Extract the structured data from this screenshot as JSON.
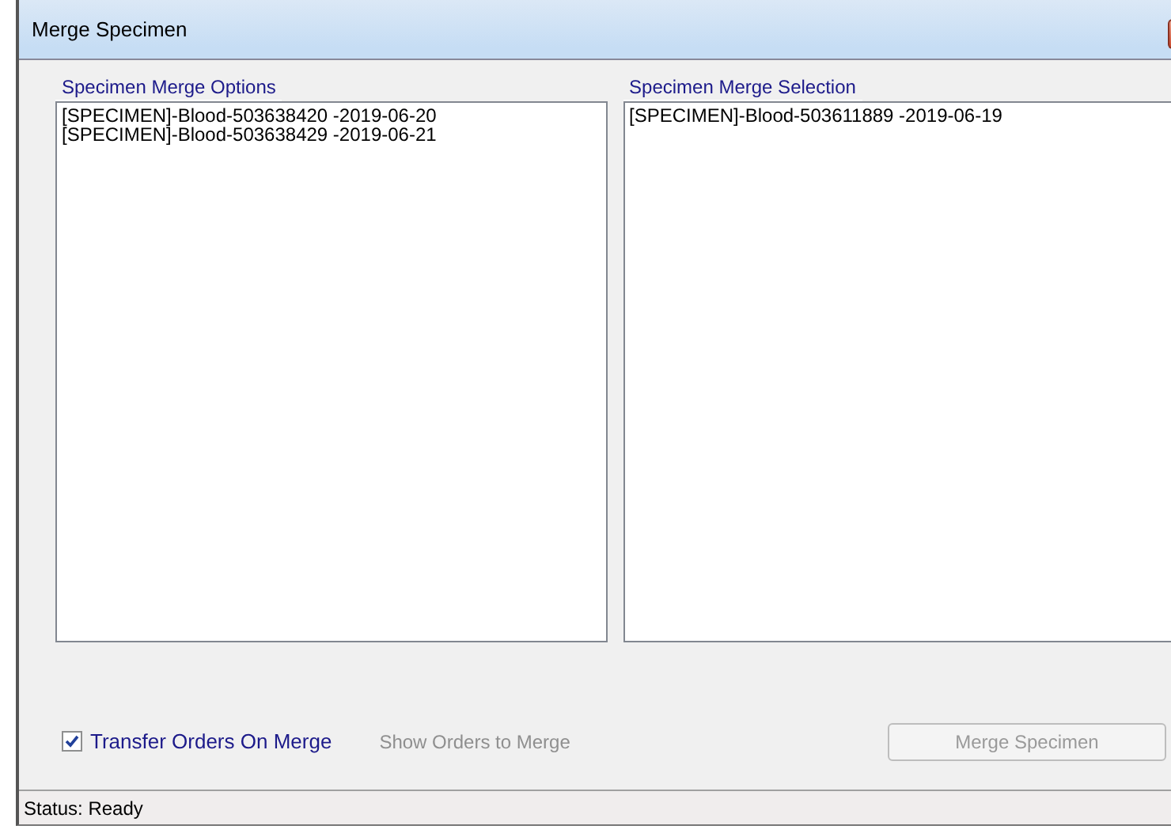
{
  "window": {
    "title": "Merge Specimen"
  },
  "options": {
    "label": "Specimen Merge Options",
    "items": [
      {
        "text": "[SPECIMEN]-Blood-503638420 -2019-06-20"
      },
      {
        "text": "[SPECIMEN]-Blood-503638429 -2019-06-21"
      }
    ]
  },
  "selection": {
    "label": "Specimen Merge Selection",
    "items": [
      {
        "text": "[SPECIMEN]-Blood-503611889 -2019-06-19"
      }
    ]
  },
  "transfer_checkbox": {
    "label": "Transfer Orders On Merge",
    "checked": true
  },
  "show_orders_link": {
    "label": "Show Orders to Merge",
    "disabled": true
  },
  "merge_button": {
    "label": "Merge Specimen",
    "disabled": true
  },
  "status_bar": {
    "text": "Status: Ready"
  }
}
